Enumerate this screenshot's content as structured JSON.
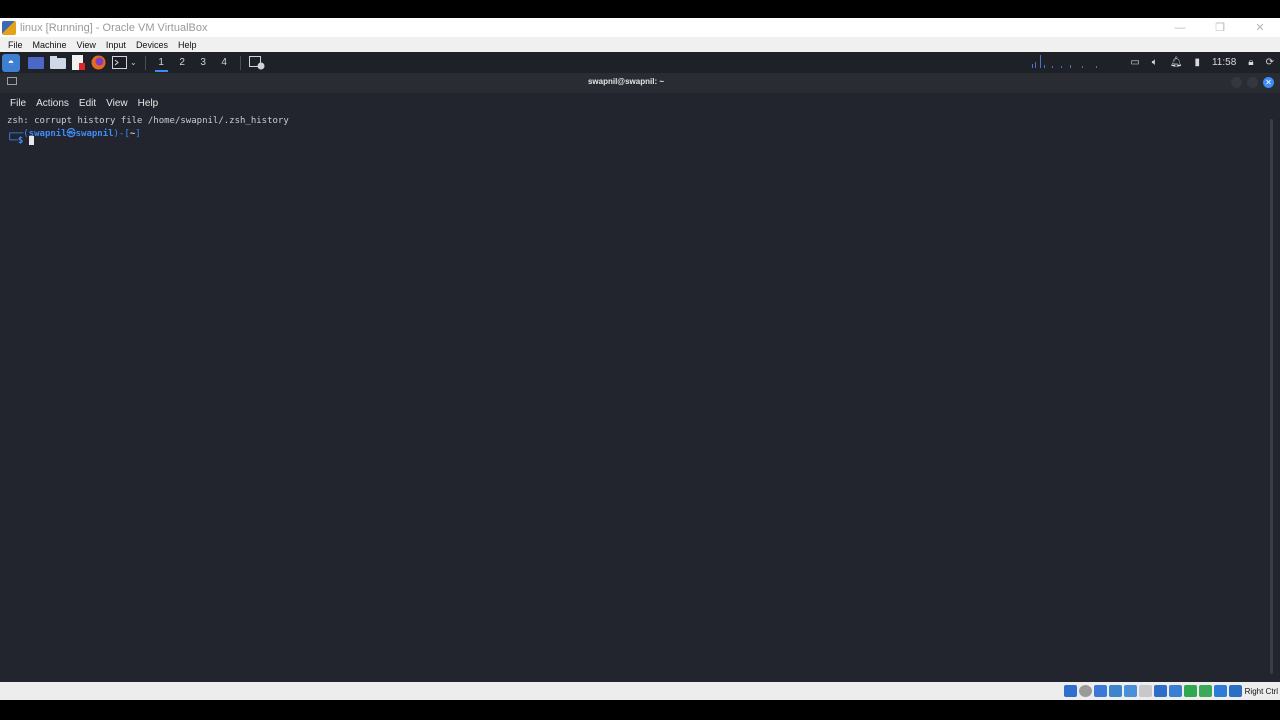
{
  "window": {
    "title": "linux [Running] - Oracle VM VirtualBox",
    "controls": {
      "minimize": "—",
      "restore": "❐",
      "close": "✕"
    }
  },
  "vbox_menu": [
    "File",
    "Machine",
    "View",
    "Input",
    "Devices",
    "Help"
  ],
  "panel": {
    "workspaces": [
      "1",
      "2",
      "3",
      "4"
    ],
    "active_workspace": "1",
    "clock": "11:58"
  },
  "terminal": {
    "title": "swapnil@swapnil: ~",
    "menu": [
      "File",
      "Actions",
      "Edit",
      "View",
      "Help"
    ],
    "lines": {
      "error": "zsh: corrupt history file /home/swapnil/.zsh_history",
      "prompt_open": "┌──(",
      "prompt_user": "swapnil㉿swapnil",
      "prompt_dir_open": ")-[",
      "prompt_dir": "~",
      "prompt_dir_close": "]",
      "prompt2_prefix": "└─",
      "prompt2_symbol": "$"
    }
  },
  "statusbar": {
    "host_key": "Right Ctrl"
  },
  "colors": {
    "terminal_bg": "#23252e",
    "prompt_blue": "#3f8cf6",
    "panel_bg": "#1f2128"
  }
}
